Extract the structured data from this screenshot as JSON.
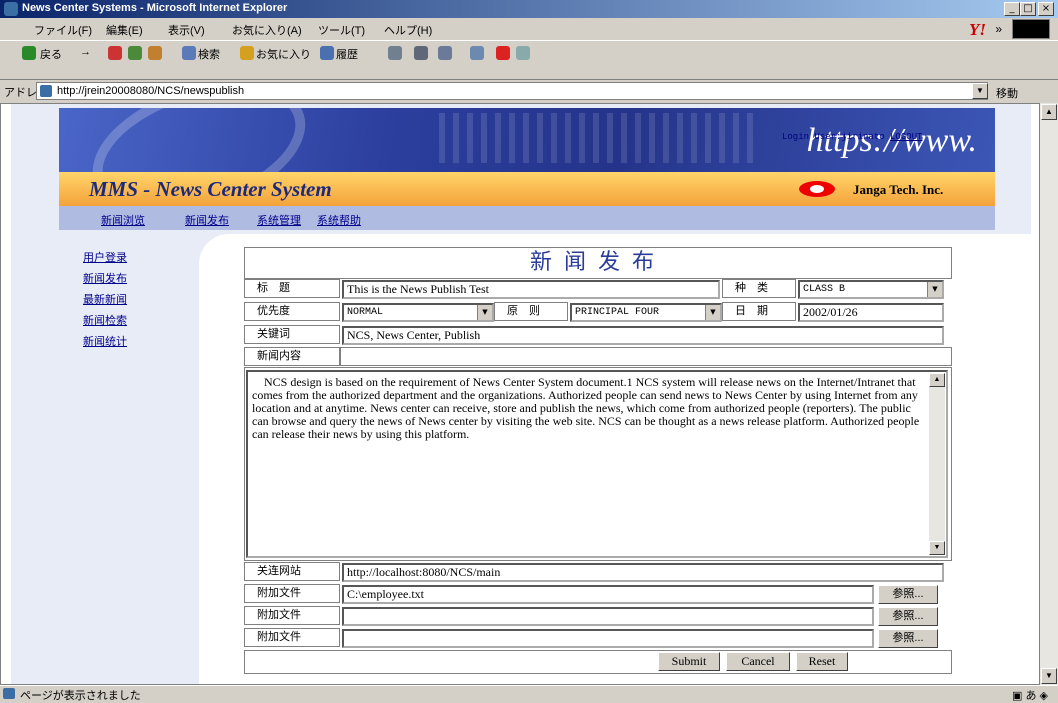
{
  "window": {
    "title": "News Center Systems - Microsoft Internet Explorer",
    "min": "_",
    "max": "□",
    "close": "×"
  },
  "menu": [
    "ファイル(F)",
    "編集(E)",
    "表示(V)",
    "お気に入り(A)",
    "ツール(T)",
    "ヘルプ(H)"
  ],
  "toolbar": {
    "back": "戻る",
    "forward": "→",
    "search": "検索",
    "favorites": "お気に入り",
    "history": "履歴",
    "chevron": "»"
  },
  "address": {
    "label": "アドレス(D)",
    "url": "http://jrein20008080/NCS/newspublish",
    "go": "移動"
  },
  "banner": {
    "https_text": "https://www."
  },
  "header": {
    "system_name": "MMS - News Center System",
    "company": "Janga Tech. Inc."
  },
  "topnav": [
    "新闻浏览",
    "新闻发布",
    "系统管理",
    "系统帮助"
  ],
  "sidebar": [
    "用户登录",
    "新闻发布",
    "最新新闻",
    "新闻检索",
    "新闻统计"
  ],
  "login": {
    "text": "Login User:jirinato",
    "logout": "LOGOUT"
  },
  "form": {
    "title": "新闻发布",
    "labels": {
      "headline": "标　题",
      "type": "种　类",
      "priority": "优先度",
      "principle": "原　则",
      "date": "日　期",
      "keywords": "关键词",
      "content": "新闻内容",
      "related": "关连网站",
      "attach1": "附加文件",
      "attach2": "附加文件",
      "attach3": "附加文件"
    },
    "values": {
      "headline": "This is the News Publish Test",
      "type": "CLASS B",
      "priority": "NORMAL",
      "principle": "PRINCIPAL FOUR",
      "date": "2002/01/26",
      "keywords": "NCS, News Center, Publish",
      "related": "http://localhost:8080/NCS/main",
      "attach1": "C:\\employee.txt",
      "attach2": "",
      "attach3": ""
    },
    "body": "NCS design is based on the requirement of News Center System document.1 NCS system will release news on the Internet/Intranet that comes from the authorized department and the organizations. Authorized people can send news to News Center by using Internet from any location and at anytime. News center can receive, store and publish the news, which come from authorized people (reporters). The public can browse and query the news of News center by visiting the web site. NCS can be thought as a news release platform. Authorized people can release their news by using this platform.",
    "browse": "参照...",
    "submit": "Submit",
    "cancel": "Cancel",
    "reset": "Reset"
  },
  "status": {
    "text": "ページが表示されました"
  }
}
